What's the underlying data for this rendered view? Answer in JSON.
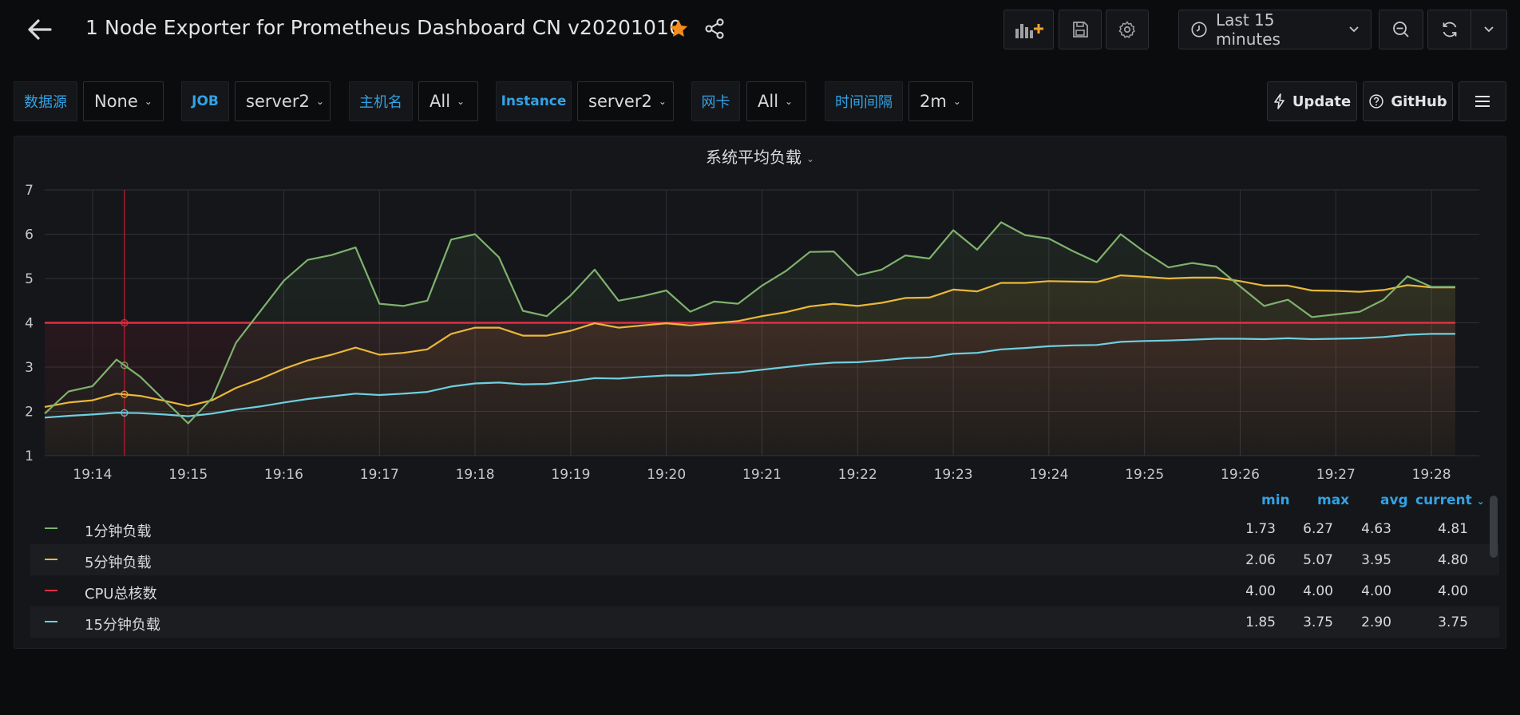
{
  "topnav": {
    "title": "1 Node Exporter for Prometheus Dashboard CN v20201010",
    "time_range": "Last 15 minutes",
    "icons": [
      "arrow-left-icon",
      "star-icon",
      "share-icon",
      "add-panel-icon",
      "save-icon",
      "gear-icon",
      "clock-icon",
      "zoom-out-icon",
      "refresh-icon",
      "chevron-down-icon"
    ],
    "star_color": "#f28c1c"
  },
  "variables": [
    {
      "label": "数据源",
      "value": "None"
    },
    {
      "label": "JOB",
      "value": "server2"
    },
    {
      "label": "主机名",
      "value": "All"
    },
    {
      "label": "Instance",
      "value": "server2"
    },
    {
      "label": "网卡",
      "value": "All"
    },
    {
      "label": "时间间隔",
      "value": "2m"
    }
  ],
  "links": {
    "update": "Update",
    "github": "GitHub"
  },
  "panel": {
    "title": "系统平均负载",
    "legend_headers": {
      "min": "min",
      "max": "max",
      "avg": "avg",
      "current": "current"
    },
    "legend": [
      {
        "name": "1分钟负载",
        "color": "#7eb26d",
        "min": "1.73",
        "max": "6.27",
        "avg": "4.63",
        "current": "4.81"
      },
      {
        "name": "5分钟负载",
        "color": "#eab839",
        "min": "2.06",
        "max": "5.07",
        "avg": "3.95",
        "current": "4.80"
      },
      {
        "name": "CPU总核数",
        "color": "#e02f44",
        "min": "4.00",
        "max": "4.00",
        "avg": "4.00",
        "current": "4.00"
      },
      {
        "name": "15分钟负载",
        "color": "#6ed0e0",
        "min": "1.85",
        "max": "3.75",
        "avg": "2.90",
        "current": "3.75"
      }
    ]
  },
  "chart_data": {
    "type": "line",
    "title": "系统平均负载",
    "xlabel": "",
    "ylabel": "",
    "xlim": [
      "19:13:30",
      "19:28:30"
    ],
    "ylim": [
      1,
      7
    ],
    "yticks": [
      1,
      2,
      3,
      4,
      5,
      6,
      7
    ],
    "xticks": [
      "19:14",
      "19:15",
      "19:16",
      "19:17",
      "19:18",
      "19:19",
      "19:20",
      "19:21",
      "19:22",
      "19:23",
      "19:24",
      "19:25",
      "19:26",
      "19:27",
      "19:28"
    ],
    "grid": true,
    "cursor_x": "19:14:20",
    "x": [
      "19:13:30",
      "19:13:45",
      "19:14:00",
      "19:14:15",
      "19:14:30",
      "19:14:45",
      "19:15:00",
      "19:15:15",
      "19:15:30",
      "19:15:45",
      "19:16:00",
      "19:16:15",
      "19:16:30",
      "19:16:45",
      "19:17:00",
      "19:17:15",
      "19:17:30",
      "19:17:45",
      "19:18:00",
      "19:18:15",
      "19:18:30",
      "19:18:45",
      "19:19:00",
      "19:19:15",
      "19:19:30",
      "19:19:45",
      "19:20:00",
      "19:20:15",
      "19:20:30",
      "19:20:45",
      "19:21:00",
      "19:21:15",
      "19:21:30",
      "19:21:45",
      "19:22:00",
      "19:22:15",
      "19:22:30",
      "19:22:45",
      "19:23:00",
      "19:23:15",
      "19:23:30",
      "19:23:45",
      "19:24:00",
      "19:24:15",
      "19:24:30",
      "19:24:45",
      "19:25:00",
      "19:25:15",
      "19:25:30",
      "19:25:45",
      "19:26:00",
      "19:26:15",
      "19:26:30",
      "19:26:45",
      "19:27:00",
      "19:27:15",
      "19:27:30",
      "19:27:45",
      "19:28:00",
      "19:28:15"
    ],
    "series": [
      {
        "name": "1分钟负载",
        "color": "#7eb26d",
        "fill": true,
        "values": [
          1.95,
          2.45,
          2.57,
          3.17,
          2.78,
          2.25,
          1.73,
          2.3,
          3.55,
          4.25,
          4.95,
          5.42,
          5.53,
          5.7,
          4.43,
          4.38,
          4.5,
          5.88,
          6.0,
          5.48,
          4.27,
          4.15,
          4.62,
          5.2,
          4.5,
          4.6,
          4.73,
          4.25,
          4.48,
          4.43,
          4.84,
          5.17,
          5.6,
          5.61,
          5.07,
          5.2,
          5.52,
          5.45,
          6.09,
          5.65,
          6.27,
          5.98,
          5.9,
          5.62,
          5.37,
          6.0,
          5.6,
          5.25,
          5.35,
          5.27,
          4.82,
          4.38,
          4.52,
          4.13,
          4.19,
          4.25,
          4.52,
          5.05,
          4.81,
          4.81
        ]
      },
      {
        "name": "5分钟负载",
        "color": "#eab839",
        "fill": true,
        "values": [
          2.1,
          2.2,
          2.25,
          2.4,
          2.35,
          2.24,
          2.12,
          2.25,
          2.53,
          2.73,
          2.96,
          3.15,
          3.28,
          3.44,
          3.28,
          3.32,
          3.4,
          3.75,
          3.89,
          3.89,
          3.71,
          3.71,
          3.82,
          3.99,
          3.89,
          3.94,
          3.99,
          3.94,
          3.99,
          4.04,
          4.15,
          4.24,
          4.37,
          4.43,
          4.38,
          4.45,
          4.56,
          4.57,
          4.75,
          4.71,
          4.9,
          4.9,
          4.94,
          4.93,
          4.92,
          5.07,
          5.04,
          5.0,
          5.02,
          5.02,
          4.94,
          4.84,
          4.84,
          4.73,
          4.72,
          4.7,
          4.74,
          4.85,
          4.8,
          4.8
        ]
      },
      {
        "name": "CPU总核数",
        "color": "#e02f44",
        "fill": true,
        "values": [
          4,
          4,
          4,
          4,
          4,
          4,
          4,
          4,
          4,
          4,
          4,
          4,
          4,
          4,
          4,
          4,
          4,
          4,
          4,
          4,
          4,
          4,
          4,
          4,
          4,
          4,
          4,
          4,
          4,
          4,
          4,
          4,
          4,
          4,
          4,
          4,
          4,
          4,
          4,
          4,
          4,
          4,
          4,
          4,
          4,
          4,
          4,
          4,
          4,
          4,
          4,
          4,
          4,
          4,
          4,
          4,
          4,
          4,
          4,
          4
        ]
      },
      {
        "name": "15分钟负载",
        "color": "#6ed0e0",
        "fill": false,
        "values": [
          1.86,
          1.9,
          1.93,
          1.97,
          1.96,
          1.93,
          1.89,
          1.95,
          2.04,
          2.11,
          2.2,
          2.28,
          2.34,
          2.4,
          2.37,
          2.4,
          2.44,
          2.56,
          2.63,
          2.65,
          2.61,
          2.62,
          2.68,
          2.75,
          2.74,
          2.78,
          2.81,
          2.81,
          2.85,
          2.88,
          2.94,
          3.0,
          3.06,
          3.1,
          3.11,
          3.15,
          3.2,
          3.22,
          3.3,
          3.32,
          3.4,
          3.43,
          3.47,
          3.49,
          3.5,
          3.57,
          3.59,
          3.6,
          3.62,
          3.64,
          3.64,
          3.63,
          3.65,
          3.63,
          3.64,
          3.65,
          3.68,
          3.73,
          3.75,
          3.75
        ]
      }
    ]
  }
}
